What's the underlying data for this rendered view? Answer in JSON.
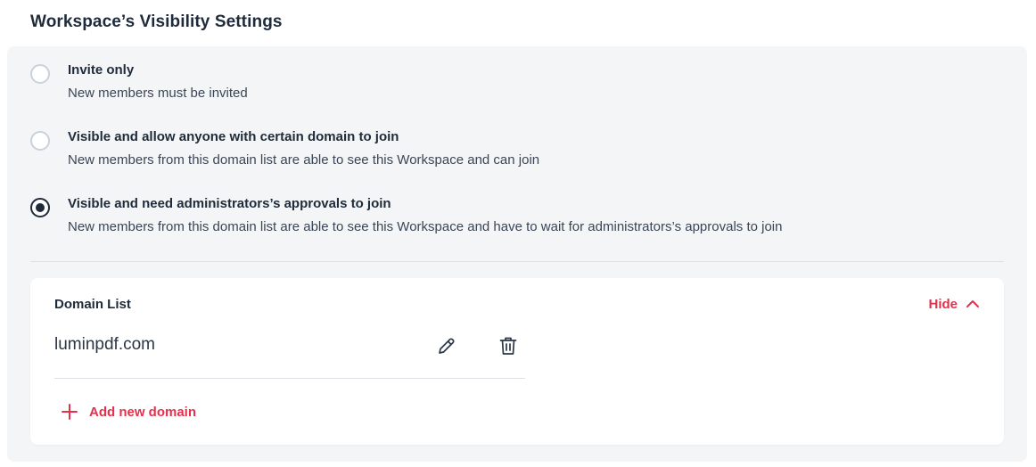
{
  "section": {
    "title": "Workspace’s Visibility Settings"
  },
  "visibility": {
    "options": [
      {
        "title": "Invite only",
        "description": "New members must be invited",
        "selected": false
      },
      {
        "title": "Visible and allow anyone with certain domain to join",
        "description": "New members from this domain list are able to see this Workspace and can join",
        "selected": false
      },
      {
        "title": "Visible and need administrators’s approvals to join",
        "description": "New members from this domain list are able to see this Workspace and have to wait for administrators’s approvals to join",
        "selected": true
      }
    ]
  },
  "domain_list": {
    "title": "Domain List",
    "hide_label": "Hide",
    "domains": [
      "luminpdf.com"
    ],
    "add_label": "Add new domain"
  },
  "colors": {
    "accent": "#e5304d",
    "text_primary": "#1f2b3a",
    "panel_bg": "#f4f5f7",
    "card_bg": "#ffffff"
  },
  "icons": {
    "hide": "chevron-up-icon",
    "edit": "pencil-icon",
    "delete": "trash-icon",
    "add": "plus-icon"
  }
}
